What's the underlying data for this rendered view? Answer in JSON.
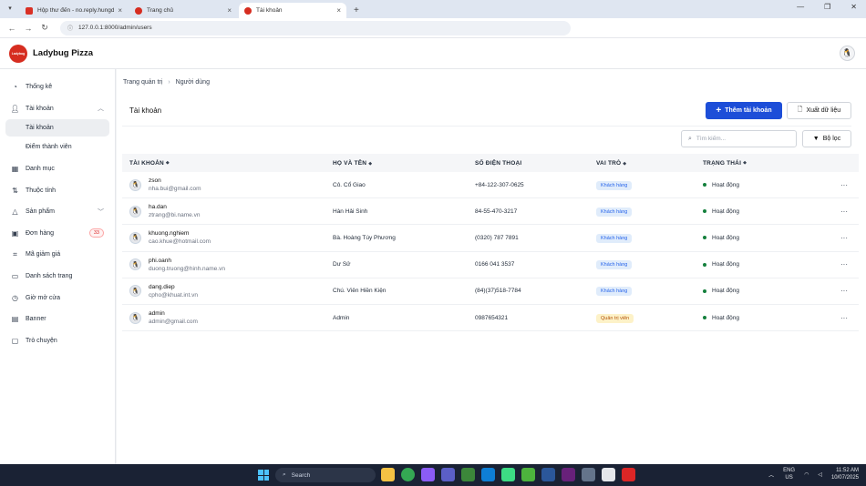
{
  "browser": {
    "tabs": [
      {
        "label": "Hộp thư đến - no.reply.hungde",
        "color": "#d93025"
      },
      {
        "label": "Trang chủ",
        "color": "#d62d20"
      },
      {
        "label": "Tài khoản",
        "color": "#d62d20",
        "active": true
      }
    ],
    "url": "127.0.0.1:8000/admin/users"
  },
  "app": {
    "brand": "Ladybug Pizza",
    "logo_text": "Ladybug"
  },
  "sidebar": {
    "items": [
      {
        "label": "Thống kê",
        "icon": "chart-pie-icon"
      },
      {
        "label": "Tài khoản",
        "icon": "user-icon"
      },
      {
        "label": "Tài khoản",
        "sub": true,
        "selected": true
      },
      {
        "label": "Điểm thành viên",
        "sub": true
      },
      {
        "label": "Danh mục",
        "icon": "grid-icon"
      },
      {
        "label": "Thuộc tính",
        "icon": "sort-icon"
      },
      {
        "label": "Sản phẩm",
        "icon": "triangle-icon"
      },
      {
        "label": "Đơn hàng",
        "icon": "box-icon",
        "badge": "33"
      },
      {
        "label": "Mã giảm giá",
        "icon": "tag-icon"
      },
      {
        "label": "Danh sách trang",
        "icon": "pages-icon"
      },
      {
        "label": "Giờ mở cửa",
        "icon": "clock-icon"
      },
      {
        "label": "Banner",
        "icon": "image-icon"
      },
      {
        "label": "Trò chuyện",
        "icon": "chat-icon"
      }
    ]
  },
  "breadcrumb": {
    "root": "Trang quản trị",
    "current": "Người dùng"
  },
  "section": {
    "title": "Tài khoản"
  },
  "actions": {
    "add": "Thêm tài khoản",
    "export": "Xuất dữ liệu",
    "filter": "Bộ lọc"
  },
  "search": {
    "placeholder": "Tìm kiếm..."
  },
  "table": {
    "headers": [
      "TÀI KHOẢN",
      "HỌ VÀ TÊN",
      "SỐ ĐIỆN THOẠI",
      "VAI TRÒ",
      "TRẠNG THÁI"
    ],
    "rows": [
      {
        "username": "zson",
        "email": "nha.bui@gmail.com",
        "fullname": "Cô. Cổ Giao",
        "phone": "+84-122-307-0625",
        "role": "Khách hàng",
        "status": "Hoạt động"
      },
      {
        "username": "ha.dan",
        "email": "ztrang@bi.name.vn",
        "fullname": "Hàn Hải Sinh",
        "phone": "84-55-470-3217",
        "role": "Khách hàng",
        "status": "Hoạt động"
      },
      {
        "username": "khuong.nghiem",
        "email": "cao.khue@hotmail.com",
        "fullname": "Bà. Hoàng Túy Phương",
        "phone": "(0320) 787 7891",
        "role": "Khách hàng",
        "status": "Hoạt động"
      },
      {
        "username": "phi.oanh",
        "email": "duong.truong@hinh.name.vn",
        "fullname": "Dư Sử",
        "phone": "0166 041 3537",
        "role": "Khách hàng",
        "status": "Hoạt động"
      },
      {
        "username": "dang.diep",
        "email": "cpho@khuat.int.vn",
        "fullname": "Chú. Viên Hiền Kiện",
        "phone": "(84)(37)518-7784",
        "role": "Khách hàng",
        "status": "Hoạt động"
      },
      {
        "username": "admin",
        "email": "admin@gmail.com",
        "fullname": "Admin",
        "phone": "0987654321",
        "role": "Quản trị viên",
        "status": "Hoạt động"
      }
    ],
    "more_glyph": "···"
  },
  "taskbar": {
    "search_placeholder": "Search",
    "lang_top": "ENG",
    "lang_bottom": "US",
    "time": "11:52 AM",
    "date": "10/07/2025"
  }
}
